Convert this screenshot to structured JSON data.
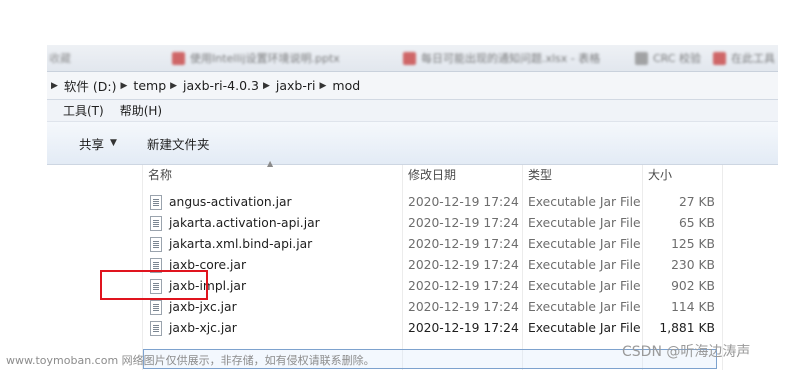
{
  "taskbar": {
    "tabs": [
      {
        "label": "收藏"
      },
      {
        "label": "使用Intellij设置环境说明.pptx"
      },
      {
        "label": "每日可能出现的通知问题.xlsx - 表格"
      },
      {
        "label": "CRC 校验"
      },
      {
        "label": "在此工具"
      }
    ]
  },
  "breadcrumb": {
    "items": [
      {
        "label": "软件 (D:)"
      },
      {
        "label": "temp"
      },
      {
        "label": "jaxb-ri-4.0.3"
      },
      {
        "label": "jaxb-ri"
      },
      {
        "label": "mod"
      }
    ]
  },
  "menu": {
    "tools": "工具(T)",
    "help": "帮助(H)"
  },
  "toolbar": {
    "share": "共享",
    "new_folder": "新建文件夹"
  },
  "columns": {
    "name": "名称",
    "date": "修改日期",
    "type": "类型",
    "size": "大小"
  },
  "files": [
    {
      "name": "angus-activation.jar",
      "date": "2020-12-19 17:24",
      "type": "Executable Jar File",
      "size": "27 KB"
    },
    {
      "name": "jakarta.activation-api.jar",
      "date": "2020-12-19 17:24",
      "type": "Executable Jar File",
      "size": "65 KB"
    },
    {
      "name": "jakarta.xml.bind-api.jar",
      "date": "2020-12-19 17:24",
      "type": "Executable Jar File",
      "size": "125 KB"
    },
    {
      "name": "jaxb-core.jar",
      "date": "2020-12-19 17:24",
      "type": "Executable Jar File",
      "size": "230 KB"
    },
    {
      "name": "jaxb-impl.jar",
      "date": "2020-12-19 17:24",
      "type": "Executable Jar File",
      "size": "902 KB"
    },
    {
      "name": "jaxb-jxc.jar",
      "date": "2020-12-19 17:24",
      "type": "Executable Jar File",
      "size": "114 KB"
    },
    {
      "name": "jaxb-xjc.jar",
      "date": "2020-12-19 17:24",
      "type": "Executable Jar File",
      "size": "1,881 KB"
    }
  ],
  "watermark": {
    "left": "www.toymoban.com 网络图片仅供展示，非存储，如有侵权请联系删除。",
    "right": "CSDN @听海边涛声"
  },
  "colors": {
    "highlight_border": "#e0141e",
    "selection_border": "#7da2ce"
  }
}
